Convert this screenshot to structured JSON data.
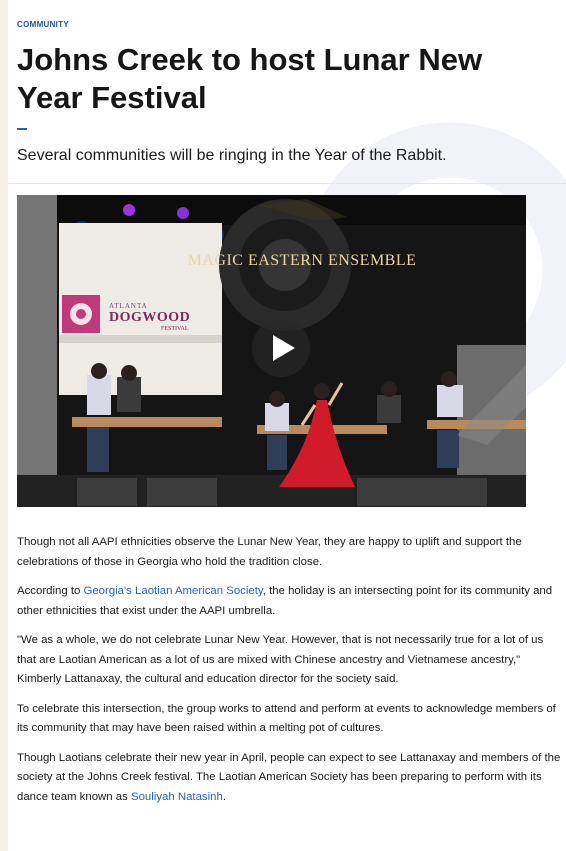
{
  "article": {
    "category": "COMMUNITY",
    "headline": "Johns Creek to host Lunar New Year Festival",
    "subheadline": "Several communities will be ringing in the Year of the Rabbit."
  },
  "video": {
    "band_title": "MAGIC EASTERN ENSEMBLE",
    "banner_small": "ATLANTA",
    "banner_big": "DOGWOOD",
    "banner_fest": "FESTIVAL",
    "play_icon": "play-icon"
  },
  "body": {
    "p1": "Though not all AAPI ethnicities observe the Lunar New Year, they are happy to uplift and support the celebrations of those in Georgia who hold the tradition close.",
    "p2_before": "According to ",
    "p2_link": "Georgia's Laotian American Society",
    "p2_after": ", the holiday is an intersecting point for its community and other ethnicities that exist under the AAPI umbrella.",
    "p3": "\"We as a whole, we do not celebrate Lunar New Year. However, that is not necessarily true for a lot of us that are Laotian American as a lot of us are mixed with Chinese ancestry and Vietnamese ancestry,\" Kimberly Lattanaxay, the cultural and education director for the society said.",
    "p4": "To celebrate this intersection, the group works to attend and perform at events to acknowledge members of its community that may have been raised within a melting pot of cultures.",
    "p5_before": "Though Laotians celebrate their new year in April, people can expect to see Lattanaxay and members of the society at the Johns Creek festival. The Laotian American Society has been preparing to perform with its dance team known as ",
    "p5_link": "Souliyah Natasinh",
    "p5_after": "."
  },
  "colors": {
    "accent": "#1f4fb8",
    "link": "#1f62c8",
    "dress": "#d11a2a"
  }
}
